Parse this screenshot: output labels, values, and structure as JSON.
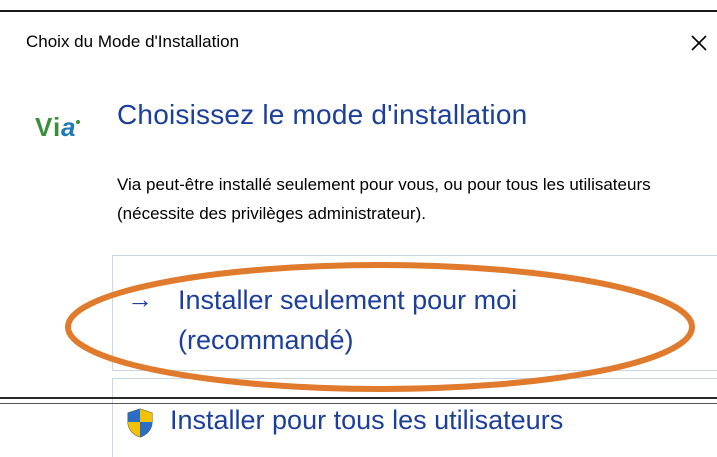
{
  "dialog": {
    "title": "Choix du Mode d'Installation",
    "close_icon": "close-icon"
  },
  "logo": {
    "text": "Via"
  },
  "main": {
    "heading": "Choisissez le mode d'installation",
    "description": "Via peut-être installé seulement pour vous, ou pour tous les utilisateurs (nécessite des privilèges administrateur)."
  },
  "options": [
    {
      "icon": "arrow-right-icon",
      "arrow": "→",
      "label": "Installer seulement pour moi (recommandé)"
    },
    {
      "icon": "uac-shield-icon",
      "label": "Installer pour tous les utilisateurs"
    }
  ],
  "colors": {
    "accent": "#1c3f9b",
    "annotation": "#e07a2c",
    "logo_green": "#3b8f3a",
    "logo_blue": "#1f7ab8"
  }
}
